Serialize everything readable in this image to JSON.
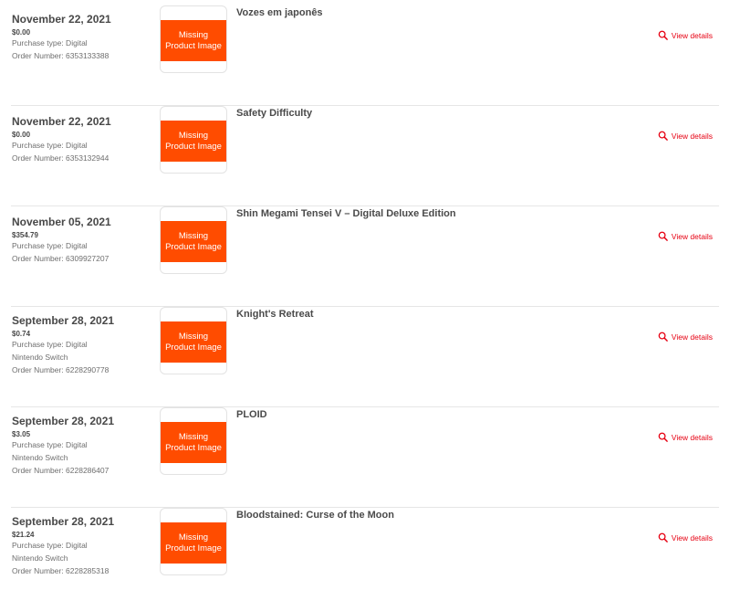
{
  "accent_color": "#e60012",
  "placeholder_color": "#ff4c00",
  "orders": [
    {
      "date": "November 22, 2021",
      "price": "$0.00",
      "purchase_type": "Purchase type: Digital",
      "platform": "",
      "order_number": "Order Number: 6353133388",
      "image_line1": "Missing",
      "image_line2": "Product Image",
      "title": "Vozes em japonês",
      "view_details": "View details",
      "action_icon": "search-icon"
    },
    {
      "date": "November 22, 2021",
      "price": "$0.00",
      "purchase_type": "Purchase type: Digital",
      "platform": "",
      "order_number": "Order Number: 6353132944",
      "image_line1": "Missing",
      "image_line2": "Product Image",
      "title": "Safety Difficulty",
      "view_details": "View details",
      "action_icon": "search-icon"
    },
    {
      "date": "November 05, 2021",
      "price": "$354.79",
      "purchase_type": "Purchase type: Digital",
      "platform": "",
      "order_number": "Order Number: 6309927207",
      "image_line1": "Missing",
      "image_line2": "Product Image",
      "title": "Shin Megami Tensei V – Digital Deluxe Edition",
      "view_details": "View details",
      "action_icon": "search-icon"
    },
    {
      "date": "September 28, 2021",
      "price": "$0.74",
      "purchase_type": "Purchase type: Digital",
      "platform": "Nintendo Switch",
      "order_number": "Order Number: 6228290778",
      "image_line1": "Missing",
      "image_line2": "Product Image",
      "title": "Knight's Retreat",
      "view_details": "View details",
      "action_icon": "search-icon"
    },
    {
      "date": "September 28, 2021",
      "price": "$3.05",
      "purchase_type": "Purchase type: Digital",
      "platform": "Nintendo Switch",
      "order_number": "Order Number: 6228286407",
      "image_line1": "Missing",
      "image_line2": "Product Image",
      "title": "PLOID",
      "view_details": "View details",
      "action_icon": "search-icon"
    },
    {
      "date": "September 28, 2021",
      "price": "$21.24",
      "purchase_type": "Purchase type: Digital",
      "platform": "Nintendo Switch",
      "order_number": "Order Number: 6228285318",
      "image_line1": "Missing",
      "image_line2": "Product Image",
      "title": "Bloodstained: Curse of the Moon",
      "view_details": "View details",
      "action_icon": "search-icon"
    }
  ]
}
